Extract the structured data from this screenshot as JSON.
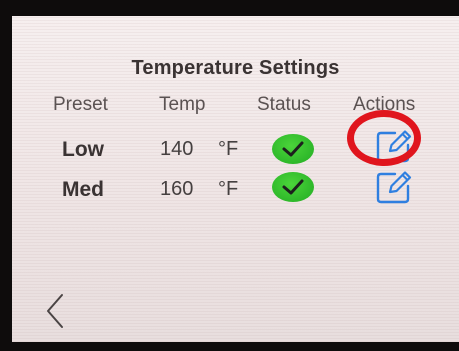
{
  "screen": {
    "title": "Temperature Settings",
    "columns": {
      "preset": "Preset",
      "temp": "Temp",
      "status": "Status",
      "actions": "Actions"
    },
    "rows": [
      {
        "preset": "Low",
        "temp": "140",
        "unit": "°F",
        "status": "enabled"
      },
      {
        "preset": "Med",
        "temp": "160",
        "unit": "°F",
        "status": "enabled"
      }
    ]
  },
  "icons": {
    "status": "checkmark-icon",
    "action": "edit-pencil-icon",
    "back": "chevron-left-icon"
  },
  "colors": {
    "screen_bg": "#f2e9e9",
    "status_green": "#2eb82a",
    "edit_blue": "#2f7fe0",
    "callout_red": "#e0151d"
  }
}
